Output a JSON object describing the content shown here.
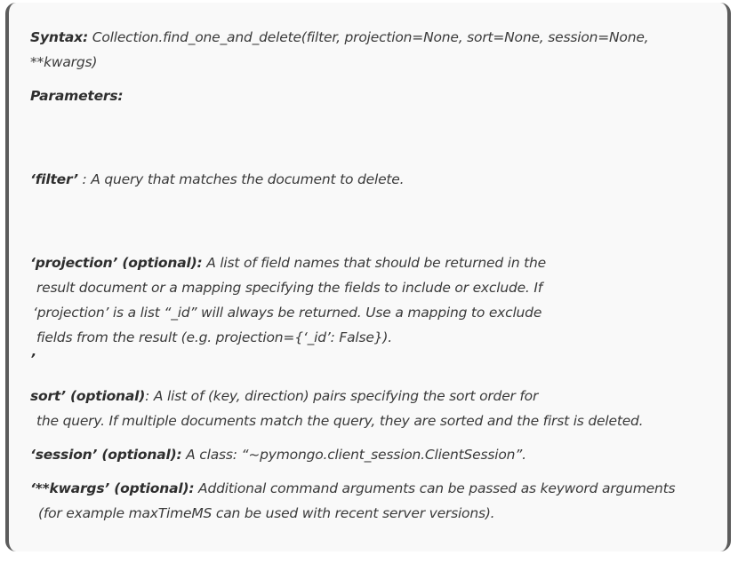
{
  "syntax": {
    "label": "Syntax:",
    "text1": " Collection.find_one_and_delete(filter, projection=None, sort=None, session=None,",
    "text2": "**kwargs)"
  },
  "parameters_heading": "Parameters:",
  "filter": {
    "label": "‘filter’",
    "text": " : A query that matches the document to delete."
  },
  "projection": {
    "label": "‘projection’ (optional):",
    "text1": " A list of field names that should be returned in the",
    "text2": "result document or a mapping specifying the fields to include or exclude. If",
    "text3": "‘projection’ is a list “_id” will always be returned. Use a mapping to exclude",
    "text4": "fields from the result (e.g. projection={‘_id’: False}).",
    "stray_quote": "’"
  },
  "sort": {
    "label": "sort’ (optional)",
    "text1": ": A list of (key, direction) pairs specifying the sort order for",
    "text2": "the query. If multiple documents match the query, they are sorted and the first is deleted."
  },
  "session": {
    "label": "‘session’ (optional):",
    "text": " A class: “~pymongo.client_session.ClientSession”."
  },
  "kwargs": {
    "label": "‘**kwargs’ (optional):",
    "text1": " Additional command arguments can be passed as keyword arguments",
    "text2": "(for example maxTimeMS can be used with recent server versions)."
  }
}
